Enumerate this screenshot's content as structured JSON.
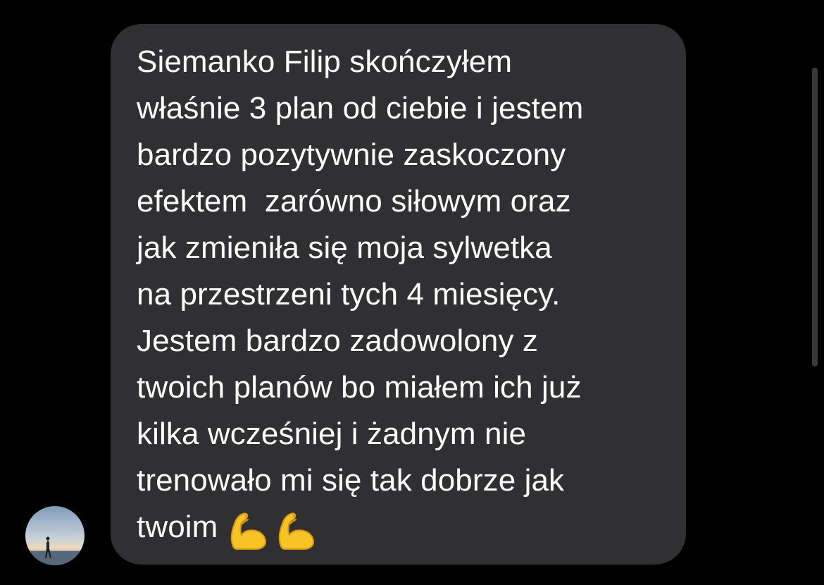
{
  "message": {
    "lines": [
      "Siemanko Filip skończyłem",
      "właśnie 3 plan od ciebie i jestem",
      "bardzo pozytywnie zaskoczony",
      "efektem  zarówno siłowym oraz",
      "jak zmieniła się moja sylwetka",
      "na przestrzeni tych 4 miesięcy.",
      "Jestem bardzo zadowolony z",
      "twoich planów bo miałem ich już",
      "kilka wcześniej i żadnym nie",
      "trenowało mi się tak dobrze jak",
      "twoim"
    ],
    "emoji": [
      "flexed-biceps",
      "flexed-biceps"
    ]
  },
  "colors": {
    "background": "#000000",
    "bubble": "#303033",
    "text": "#ffffff",
    "scrollbar": "#3a3a3d"
  }
}
